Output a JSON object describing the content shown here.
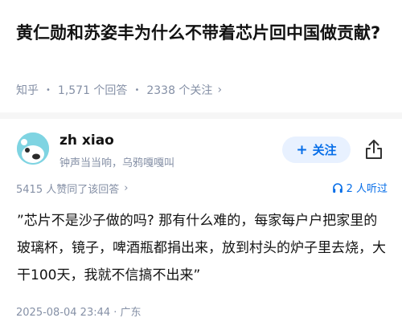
{
  "question": {
    "title": "黄仁勋和苏姿丰为什么不带着芯片回中国做贡献?",
    "source": "知乎",
    "answer_count": "1,571 个回答",
    "follower_count": "2338 个关注"
  },
  "author": {
    "name": "zh xiao",
    "bio": "钟声当当响，乌鸦嘎嘎叫",
    "follow_label": "关注"
  },
  "answer": {
    "stats": "5415 人赞同了该回答",
    "listen": "2 人听过",
    "content": "”芯片不是沙子做的吗? 那有什么难的，每家每户户把家里的玻璃杯，镜子，啤酒瓶都捐出来，放到村头的炉子里去烧，大干100天，我就不信搞不出来”",
    "datetime": "2025-08-04 23:44 · 广东"
  },
  "colors": {
    "accent": "#056de8",
    "muted": "#8590a6",
    "follow_bg": "#e8f1ff"
  },
  "icons": {
    "share": "share-icon",
    "headphones": "headphones-icon",
    "chevron": "chevron-right-icon"
  }
}
